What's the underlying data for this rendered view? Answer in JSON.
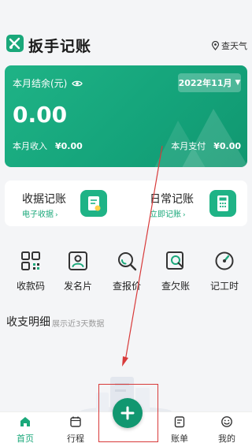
{
  "header": {
    "app_title": "扳手记账",
    "weather_label": "查天气"
  },
  "balance_card": {
    "label": "本月结余(元)",
    "month": "2022年11月",
    "balance": "0.00",
    "income_label": "本月收入",
    "income_value": "¥0.00",
    "expense_label": "本月支付",
    "expense_value": "¥0.00"
  },
  "quick_actions": [
    {
      "title": "收据记账",
      "sub": "电子收据"
    },
    {
      "title": "日常记账",
      "sub": "立即记账"
    }
  ],
  "tools": [
    {
      "label": "收款码",
      "icon": "qrcode-icon"
    },
    {
      "label": "发名片",
      "icon": "business-card-icon"
    },
    {
      "label": "查报价",
      "icon": "search-price-icon"
    },
    {
      "label": "查欠账",
      "icon": "search-debt-icon"
    },
    {
      "label": "记工时",
      "icon": "gauge-icon"
    }
  ],
  "records": {
    "title": "收支明细",
    "subtitle": "展示近3天数据"
  },
  "tabbar": [
    {
      "label": "首页",
      "icon": "home-icon",
      "active": true
    },
    {
      "label": "行程",
      "icon": "calendar-icon",
      "active": false
    },
    {
      "label": "账单",
      "icon": "bill-icon",
      "active": false
    },
    {
      "label": "我的",
      "icon": "smile-icon",
      "active": false
    }
  ],
  "colors": {
    "accent": "#1aa87a",
    "annotation": "#d83a3a"
  }
}
